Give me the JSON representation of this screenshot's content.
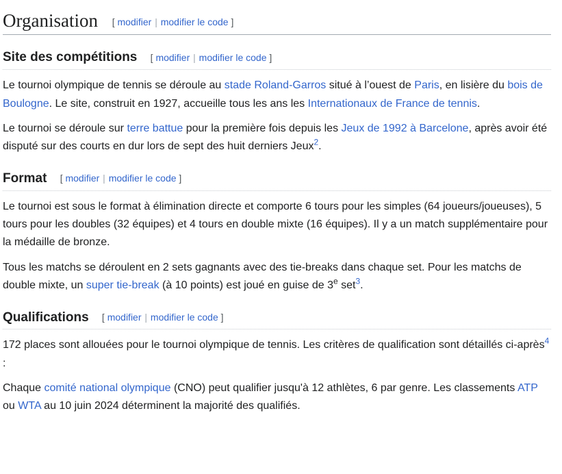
{
  "edit": {
    "open": "[",
    "close": "]",
    "modifier": "modifier",
    "sep": "|",
    "modifier_code": "modifier le code"
  },
  "organisation": {
    "title": "Organisation"
  },
  "site": {
    "title": "Site des compétitions",
    "p1": {
      "t1": "Le tournoi olympique de tennis se déroule au ",
      "l1": "stade Roland-Garros",
      "t2": " situé à l’ouest de ",
      "l2": "Paris",
      "t3": ", en lisière du ",
      "l3": "bois de Boulogne",
      "t4": ". Le site, construit en 1927, accueille tous les ans les ",
      "l4": "Internationaux de France de tennis",
      "t5": "."
    },
    "p2": {
      "t1": "Le tournoi se déroule sur ",
      "l1": "terre battue",
      "t2": " pour la première fois depuis les ",
      "l2": "Jeux de 1992 à Barcelone",
      "t3": ", après avoir été disputé sur des courts en dur lors de sept des huit derniers Jeux",
      "ref": "2",
      "t4": "."
    }
  },
  "format": {
    "title": "Format",
    "p1": "Le tournoi est sous le format à élimination directe et comporte 6 tours pour les simples (64 joueurs/joueuses), 5 tours pour les doubles (32 équipes) et 4 tours en double mixte (16 équipes). Il y a un match supplémentaire pour la médaille de bronze.",
    "p2": {
      "t1": "Tous les matchs se déroulent en 2 sets gagnants avec des tie-breaks dans chaque set. Pour les matchs de double mixte, un ",
      "l1": "super tie-break",
      "t2": " (à 10 points) est joué en guise de 3",
      "sup": "e",
      "t3": " set",
      "ref": "3",
      "t4": "."
    }
  },
  "qualifications": {
    "title": "Qualifications",
    "p1": {
      "t1": "172 places sont allouées pour le tournoi olympique de tennis. Les critères de qualification sont détaillés ci-après",
      "ref": "4",
      "t2": " :"
    },
    "p2": {
      "t1": "Chaque ",
      "l1": "comité national olympique",
      "t2": " (CNO) peut qualifier jusqu'à 12 athlètes, 6 par genre. Les classements ",
      "l2": "ATP",
      "t3": " ou ",
      "l3": "WTA",
      "t4": " au 10 juin 2024 déterminent la majorité des qualifiés."
    }
  }
}
